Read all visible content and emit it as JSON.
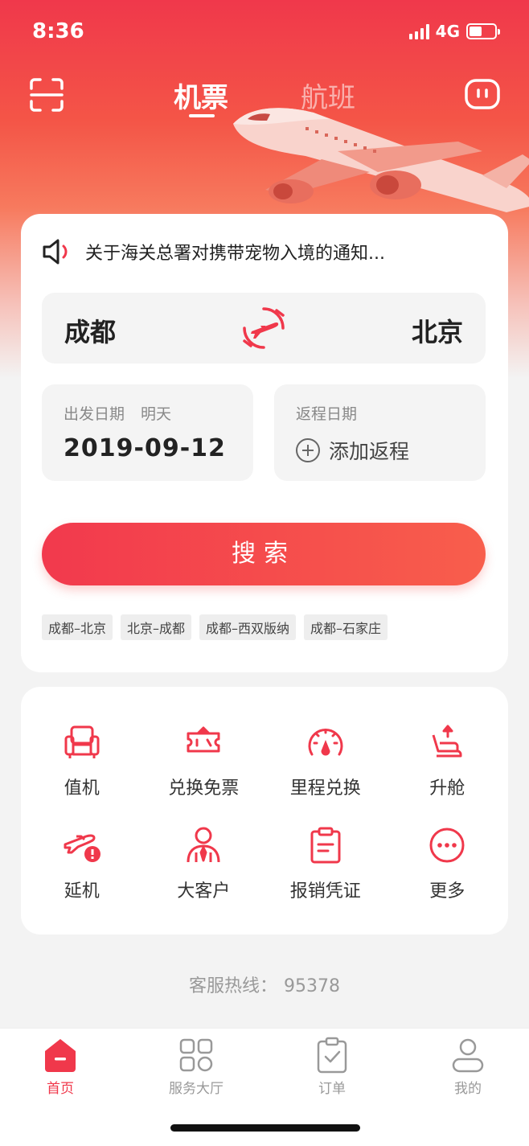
{
  "status_bar": {
    "time": "8:36",
    "network": "4G"
  },
  "header": {
    "tabs": [
      {
        "label": "机票",
        "active": true
      },
      {
        "label": "航班",
        "active": false
      }
    ],
    "scan_icon": "scan-icon",
    "message_icon": "message-icon"
  },
  "notice": {
    "text": "关于海关总署对携带宠物入境的通知..."
  },
  "route": {
    "from": "成都",
    "to": "北京"
  },
  "depart": {
    "label": "出发日期",
    "relative": "明天",
    "date": "2019-09-12"
  },
  "return": {
    "label": "返程日期",
    "add_label": "添加返程"
  },
  "search": {
    "label": "搜索"
  },
  "history": [
    "成都–北京",
    "北京–成都",
    "成都–西双版纳",
    "成都–石家庄"
  ],
  "services": [
    {
      "label": "值机",
      "icon": "seat-icon"
    },
    {
      "label": "兑换免票",
      "icon": "ticket-icon"
    },
    {
      "label": "里程兑换",
      "icon": "gauge-icon"
    },
    {
      "label": "升舱",
      "icon": "upgrade-seat-icon"
    },
    {
      "label": "延机",
      "icon": "flight-delay-icon"
    },
    {
      "label": "大客户",
      "icon": "vip-customer-icon"
    },
    {
      "label": "报销凭证",
      "icon": "receipt-icon"
    },
    {
      "label": "更多",
      "icon": "more-icon"
    }
  ],
  "hotline": {
    "label": "客服热线：",
    "number": "95378"
  },
  "tabbar": [
    {
      "label": "首页",
      "icon": "home-icon",
      "active": true
    },
    {
      "label": "服务大厅",
      "icon": "grid-icon",
      "active": false
    },
    {
      "label": "订单",
      "icon": "order-icon",
      "active": false
    },
    {
      "label": "我的",
      "icon": "profile-icon",
      "active": false
    }
  ],
  "colors": {
    "brand": "#f0384b",
    "brand_end": "#f85e4c",
    "text": "#222222",
    "muted": "#999999"
  }
}
